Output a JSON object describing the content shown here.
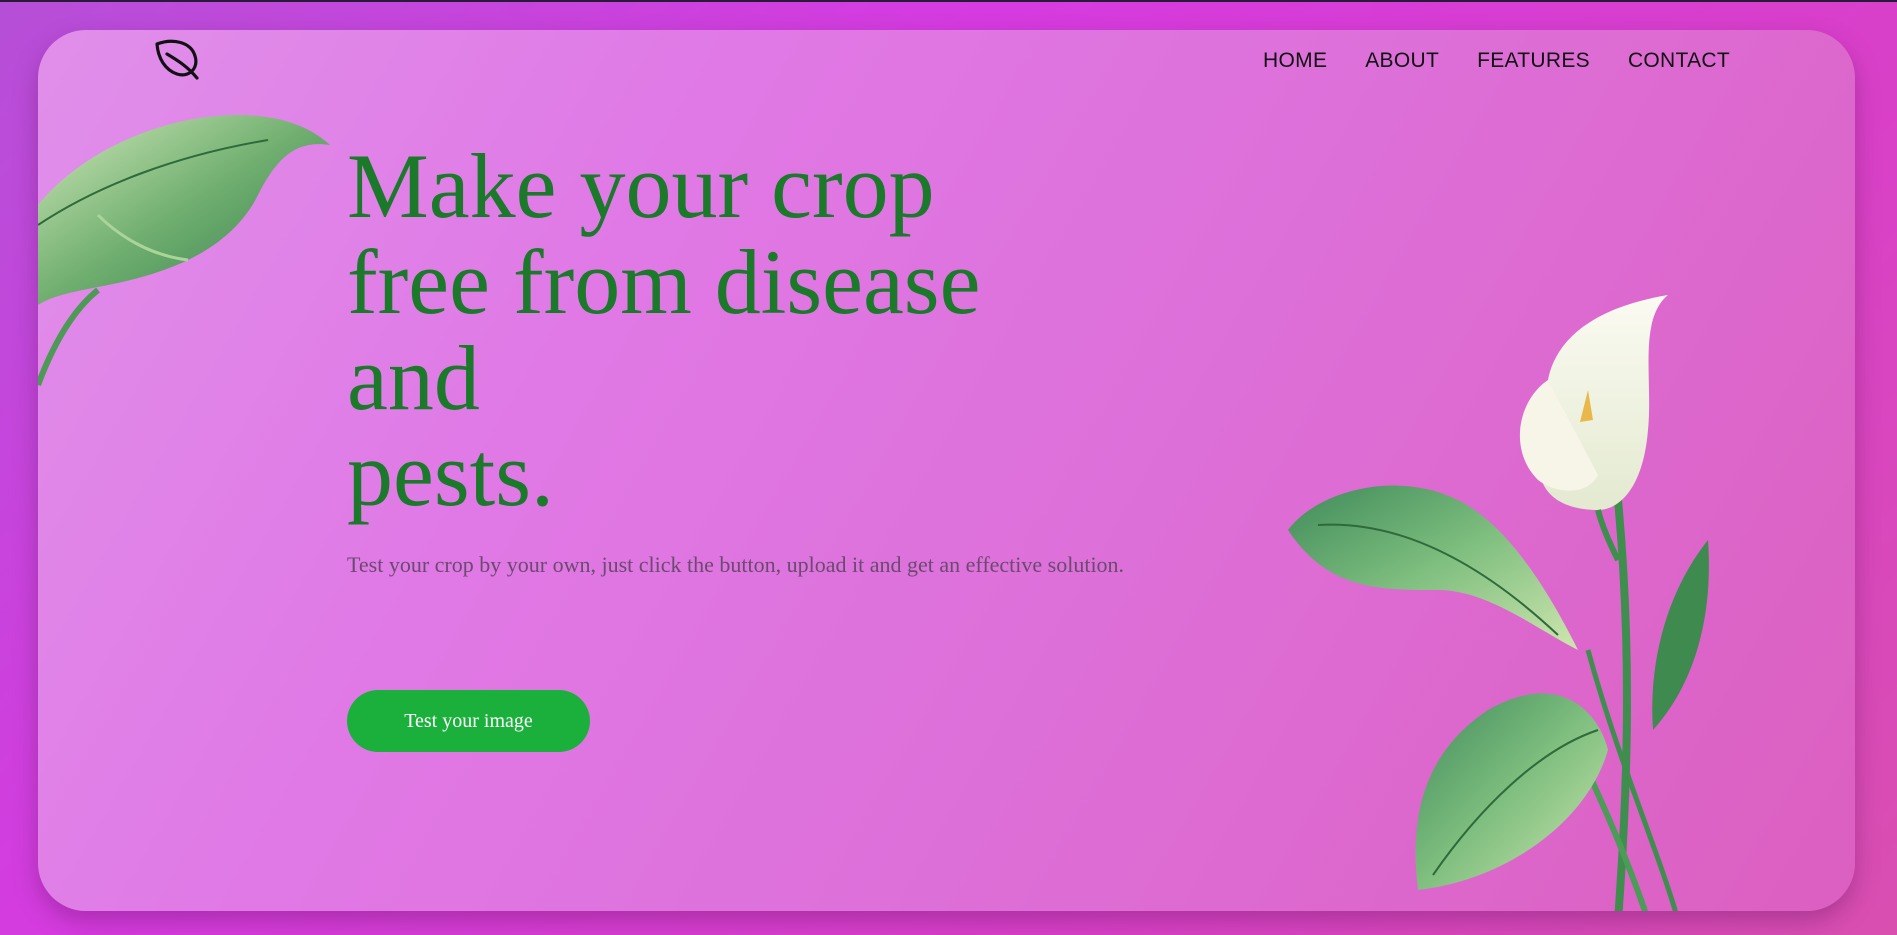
{
  "nav": {
    "items": [
      {
        "label": "HOME"
      },
      {
        "label": "ABOUT"
      },
      {
        "label": "FEATURES"
      },
      {
        "label": "CONTACT"
      }
    ]
  },
  "hero": {
    "headline_lines": [
      "Make your crop",
      "free from disease",
      "and",
      "pests."
    ],
    "subtitle": "Test your crop by your own, just click the button, upload it and get an effective solution.",
    "cta_label": "Test your image"
  },
  "colors": {
    "headline": "#1a7a2a",
    "cta": "#1bb03c",
    "background": "#d63be0",
    "card": "#e079e6"
  },
  "icons": {
    "logo": "leaf-icon"
  }
}
